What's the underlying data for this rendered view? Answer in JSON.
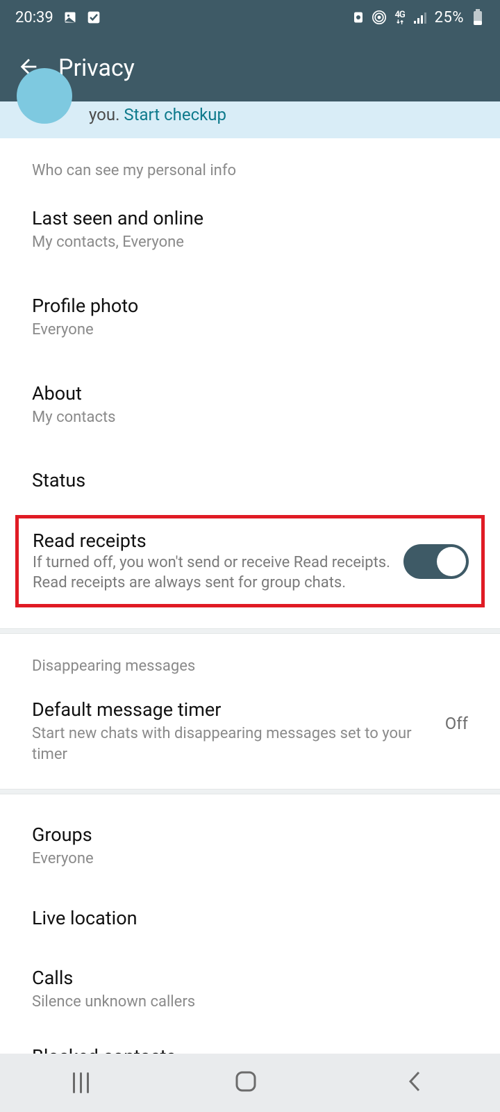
{
  "status_bar": {
    "time": "20:39",
    "battery_pct": "25%"
  },
  "app_bar": {
    "title": "Privacy"
  },
  "banner": {
    "text_prefix": "you. ",
    "link": "Start checkup"
  },
  "sections": {
    "personal_info_header": "Who can see my personal info",
    "last_seen": {
      "title": "Last seen and online",
      "sub": "My contacts, Everyone"
    },
    "profile_photo": {
      "title": "Profile photo",
      "sub": "Everyone"
    },
    "about": {
      "title": "About",
      "sub": "My contacts"
    },
    "status": {
      "title": "Status"
    },
    "read_receipts": {
      "title": "Read receipts",
      "sub": "If turned off, you won't send or receive Read receipts. Read receipts are always sent for group chats."
    },
    "disappearing_header": "Disappearing messages",
    "default_timer": {
      "title": "Default message timer",
      "sub": "Start new chats with disappearing messages set to your timer",
      "value": "Off"
    },
    "groups": {
      "title": "Groups",
      "sub": "Everyone"
    },
    "live_location": {
      "title": "Live location"
    },
    "calls": {
      "title": "Calls",
      "sub": "Silence unknown callers"
    },
    "blocked": {
      "title": "Blocked contacts"
    }
  }
}
